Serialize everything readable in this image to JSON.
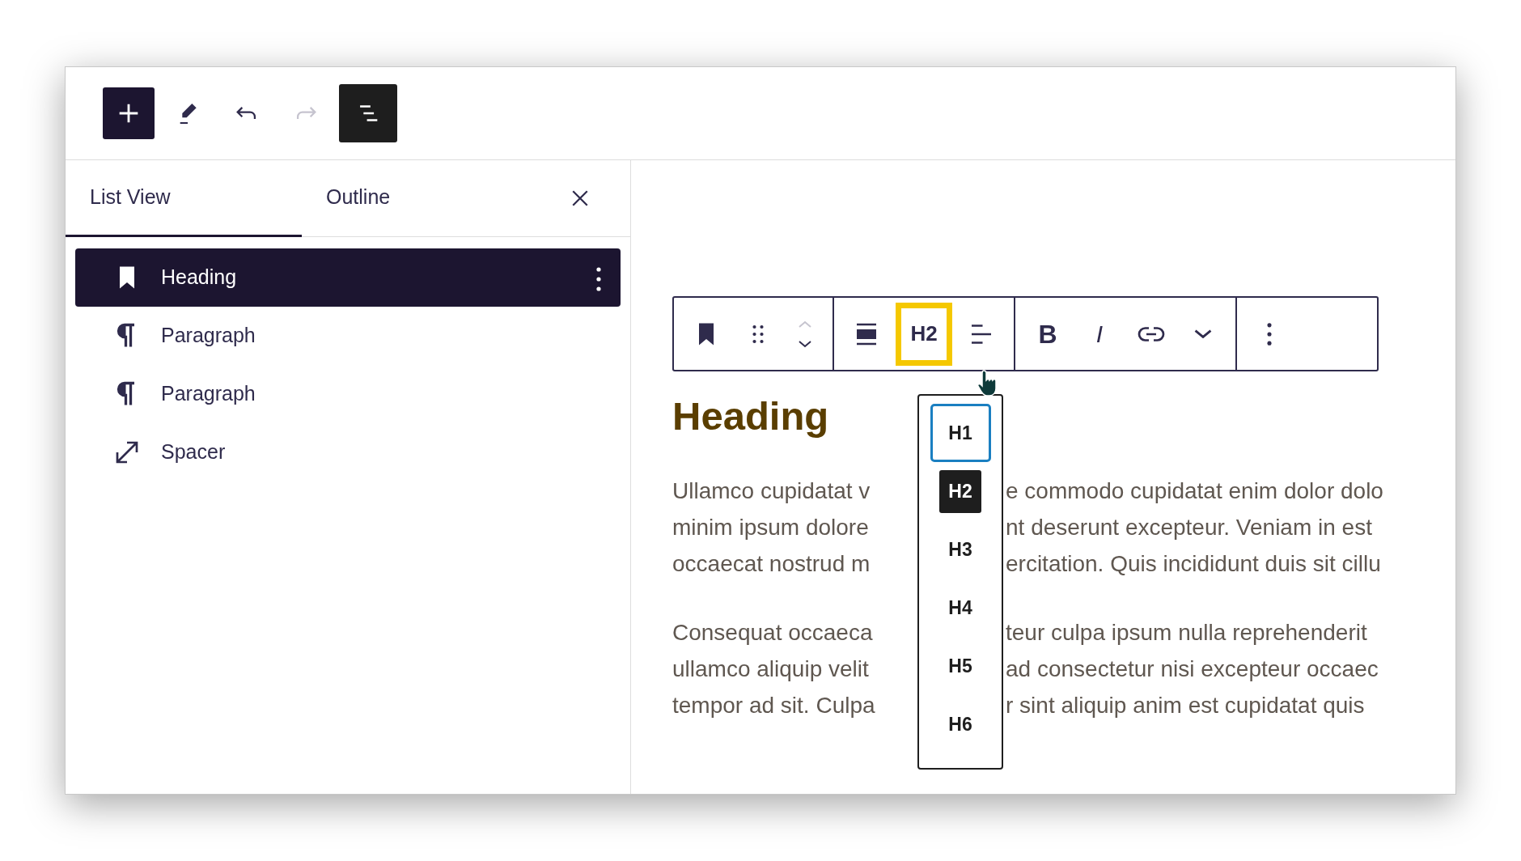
{
  "top_toolbar": [
    {
      "kind": "add",
      "pressed": false,
      "disabled": false
    },
    {
      "kind": "edit",
      "pressed": false,
      "disabled": false
    },
    {
      "kind": "undo",
      "pressed": false,
      "disabled": false
    },
    {
      "kind": "redo",
      "pressed": false,
      "disabled": true
    },
    {
      "kind": "list_view",
      "pressed": true,
      "disabled": false
    }
  ],
  "sidebar": {
    "tabs": [
      {
        "label": "List View",
        "selected": true
      },
      {
        "label": "Outline",
        "selected": false
      }
    ],
    "items": [
      {
        "kind": "heading",
        "label": "Heading",
        "selected": true
      },
      {
        "kind": "paragraph",
        "label": "Paragraph",
        "selected": false
      },
      {
        "kind": "paragraph",
        "label": "Paragraph",
        "selected": false
      },
      {
        "kind": "spacer",
        "label": "Spacer",
        "selected": false
      }
    ]
  },
  "block_toolbar": {
    "groups": [
      [
        {
          "kind": "block_type"
        },
        {
          "kind": "drag"
        },
        {
          "kind": "mover",
          "up_disabled": true
        }
      ],
      [
        {
          "kind": "align"
        },
        {
          "kind": "heading_level",
          "label": "H2",
          "highlighted": true
        },
        {
          "kind": "text_align"
        }
      ],
      [
        {
          "kind": "bold",
          "label": "B"
        },
        {
          "kind": "italic",
          "label": "I"
        },
        {
          "kind": "link"
        },
        {
          "kind": "more"
        }
      ],
      [
        {
          "kind": "options"
        }
      ]
    ]
  },
  "heading_menu": {
    "items": [
      {
        "label": "H1",
        "selected": false,
        "focused": true
      },
      {
        "label": "H2",
        "selected": true,
        "focused": false
      },
      {
        "label": "H3",
        "selected": false,
        "focused": false
      },
      {
        "label": "H4",
        "selected": false,
        "focused": false
      },
      {
        "label": "H5",
        "selected": false,
        "focused": false
      },
      {
        "label": "H6",
        "selected": false,
        "focused": false
      }
    ]
  },
  "content": {
    "heading": "Heading",
    "paragraphs": [
      {
        "lines": [
          {
            "left": "Ullamco cupidatat v",
            "right": "e commodo cupidatat enim dolor dolo"
          },
          {
            "left": "minim ipsum dolore",
            "right": "nt deserunt excepteur. Veniam in est"
          },
          {
            "left": "occaecat nostrud m",
            "right": "ercitation. Quis incididunt duis sit cillu"
          }
        ]
      },
      {
        "lines": [
          {
            "left": "Consequat occaeca",
            "right": "teur culpa ipsum nulla reprehenderit"
          },
          {
            "left": "ullamco aliquip velit",
            "right": "ad consectetur nisi excepteur occaec"
          },
          {
            "left": "tempor ad sit. Culpa",
            "right": "r sint aliquip anim est cupidatat quis"
          }
        ]
      }
    ]
  }
}
